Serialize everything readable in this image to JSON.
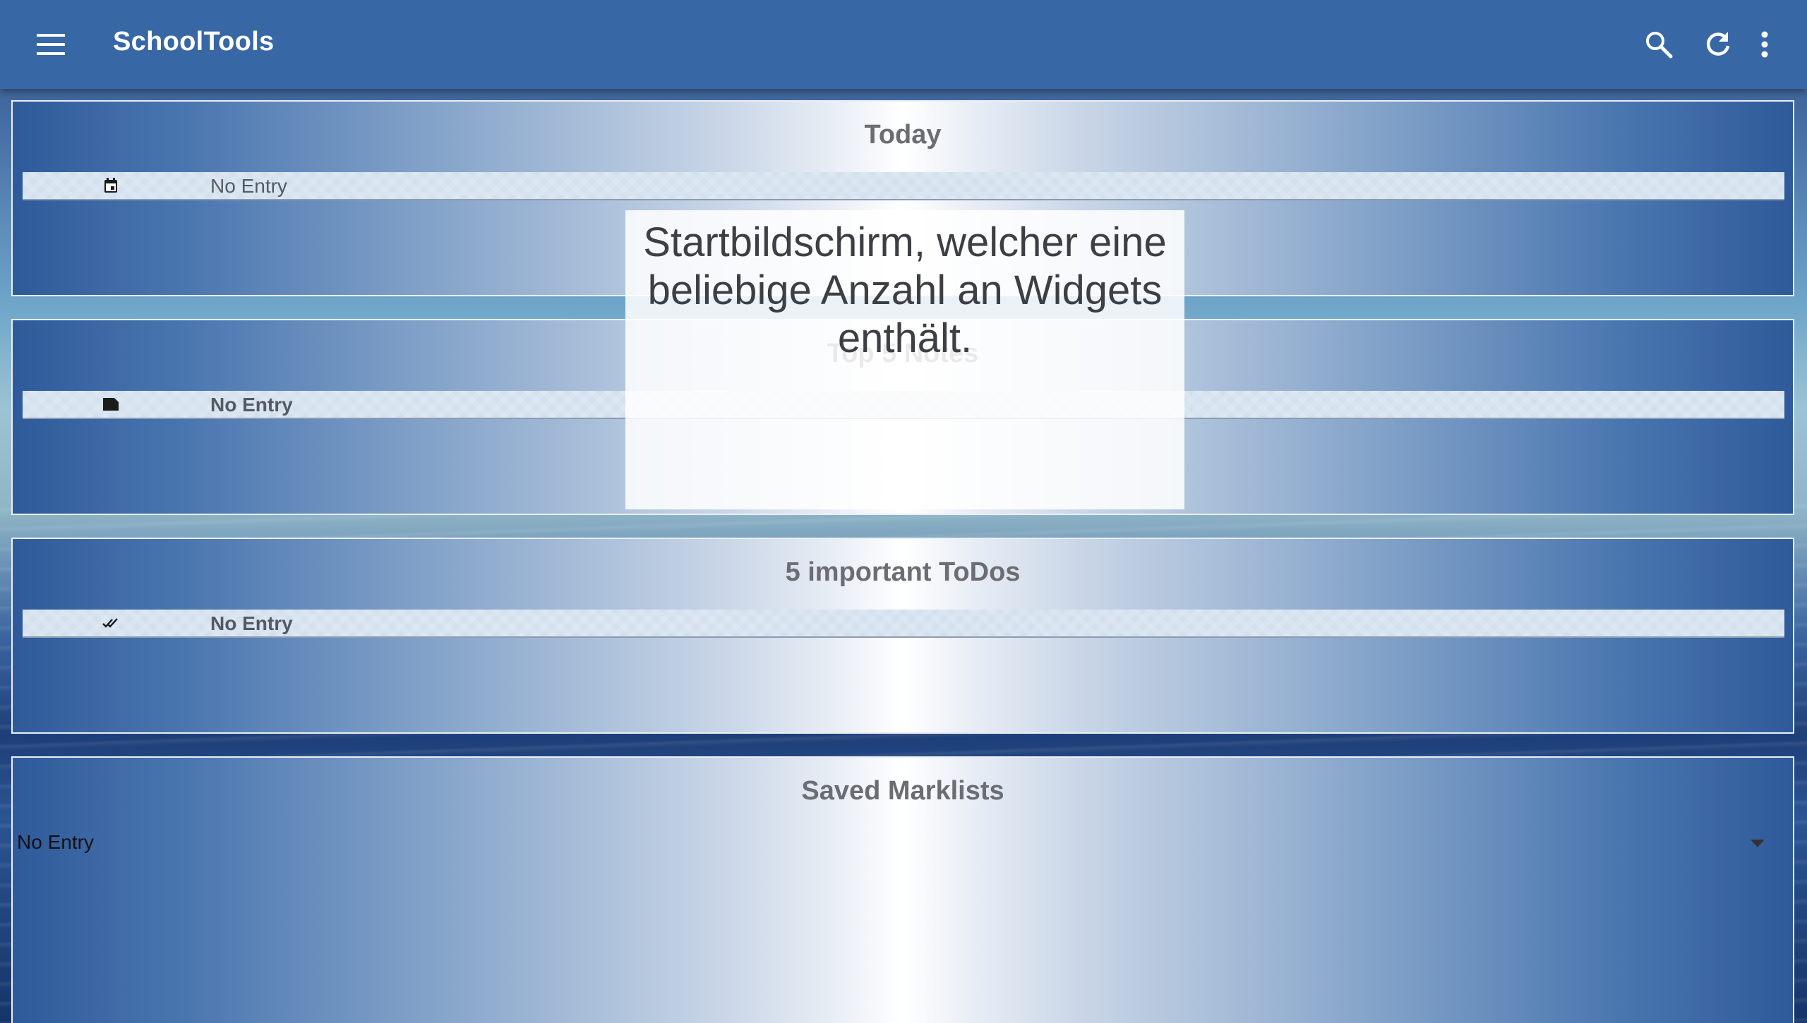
{
  "app": {
    "title": "SchoolTools"
  },
  "icons": {
    "menu": "menu-icon",
    "search": "search-icon",
    "refresh": "refresh-icon",
    "more": "more-vert-icon"
  },
  "widgets": {
    "today": {
      "title": "Today",
      "entry": "No Entry",
      "icon": "calendar-icon"
    },
    "notes": {
      "title": "Top 5 Notes",
      "entry": "No Entry",
      "icon": "note-icon"
    },
    "todos": {
      "title": "5 important ToDos",
      "entry": "No Entry",
      "icon": "done-all-icon"
    },
    "marklists": {
      "title": "Saved Marklists",
      "selected": "No Entry",
      "icon": "dropdown-arrow-icon"
    }
  },
  "overlay": {
    "text": "Startbildschirm, welcher eine beliebige Anzahl an Widgets enthält."
  },
  "colors": {
    "appbar": "#3867a6",
    "title_text": "#6b6d72",
    "row_bg": "#d3e0ee"
  }
}
